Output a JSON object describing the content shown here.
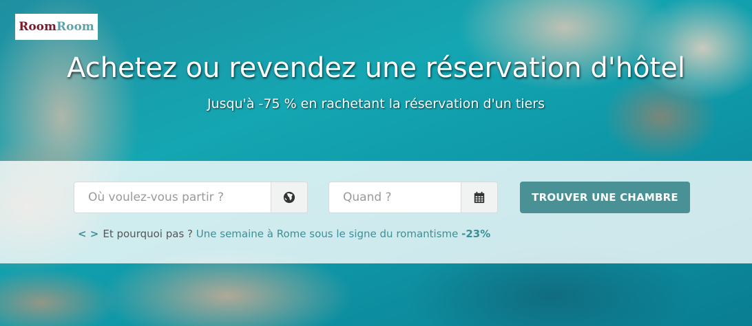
{
  "brand": {
    "part1": "Room",
    "part2": "Room"
  },
  "hero": {
    "title": "Achetez ou revendez une réservation d'hôtel",
    "subtitle": "Jusqu'à -75 % en rachetant la réservation d'un tiers"
  },
  "search": {
    "destination_placeholder": "Où voulez-vous partir ?",
    "destination_icon": "globe-icon",
    "date_placeholder": "Quand ?",
    "date_icon": "calendar-icon",
    "submit_label": "TROUVER UNE CHAMBRE"
  },
  "suggestion": {
    "arrows": "< >",
    "prefix": "Et pourquoi pas ?",
    "link_text": "Une semaine à Rome sous le signe du romantisme",
    "discount": "-23%"
  },
  "colors": {
    "accent": "#4a9196",
    "brand_red": "#7a1a2e",
    "brand_teal": "#5da3ab"
  }
}
